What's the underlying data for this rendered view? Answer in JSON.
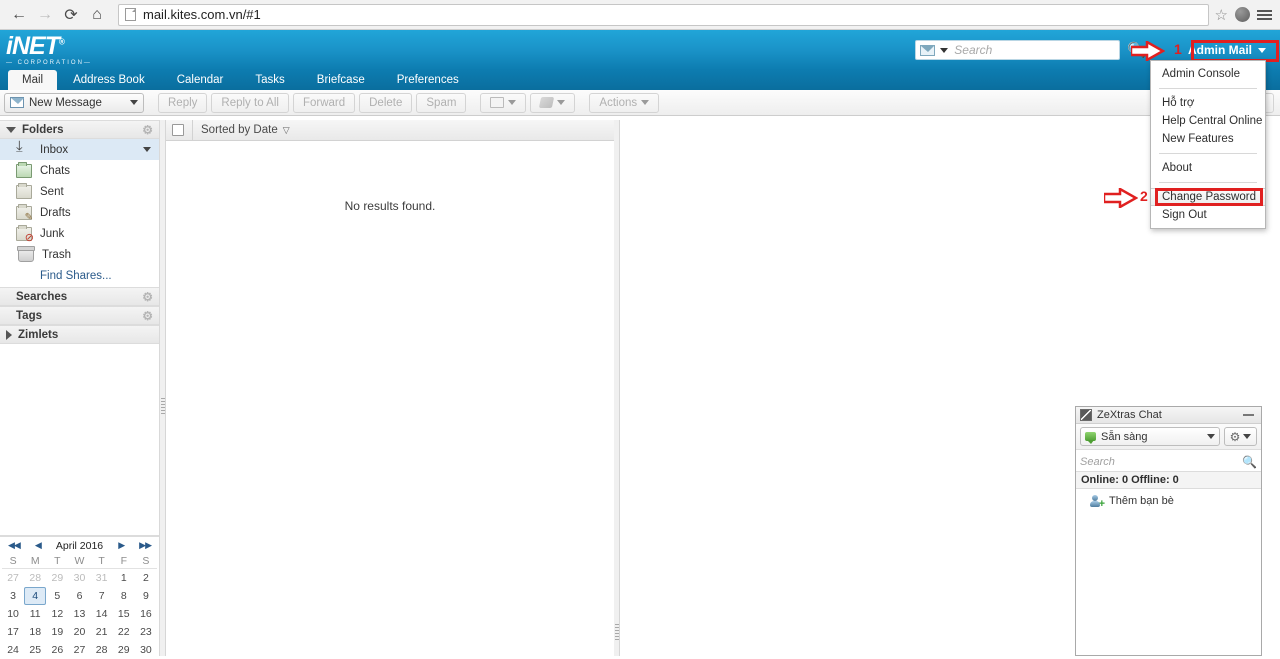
{
  "browser": {
    "back_icon": "←",
    "forward_icon": "→",
    "reload_icon": "⟳",
    "home_icon": "⌂",
    "url": "mail.kites.com.vn/#1",
    "star_icon": "☆",
    "profile_icon": "profile-globe-icon",
    "menu_icon": "hamburger-menu-icon"
  },
  "header": {
    "logo_text": "iNET",
    "logo_reg": "®",
    "logo_sub": "CORPORATION",
    "search": {
      "placeholder": "Search",
      "scope_icon": "envelope-icon"
    },
    "search_button_icon": "🔍",
    "account_label": "Admin Mail"
  },
  "annotations": [
    {
      "id": "1",
      "label": "1"
    },
    {
      "id": "2",
      "label": "2"
    }
  ],
  "tabs": [
    {
      "label": "Mail",
      "active": true
    },
    {
      "label": "Address Book",
      "active": false
    },
    {
      "label": "Calendar",
      "active": false
    },
    {
      "label": "Tasks",
      "active": false
    },
    {
      "label": "Briefcase",
      "active": false
    },
    {
      "label": "Preferences",
      "active": false
    }
  ],
  "toolbar": {
    "new_message": "New Message",
    "reply": "Reply",
    "reply_all": "Reply to All",
    "forward": "Forward",
    "delete": "Delete",
    "spam": "Spam",
    "move_icon": "move-to-folder-icon",
    "tag_icon": "tag-icon",
    "actions": "Actions"
  },
  "account_menu": {
    "items": [
      {
        "label": "Admin Console",
        "sep_after": true,
        "highlight": false
      },
      {
        "label": "Hỗ trợ",
        "sep_after": false,
        "highlight": false
      },
      {
        "label": "Help Central Online",
        "sep_after": false,
        "highlight": false
      },
      {
        "label": "New Features",
        "sep_after": true,
        "highlight": false
      },
      {
        "label": "About",
        "sep_after": true,
        "highlight": false
      },
      {
        "label": "Change Password",
        "sep_after": false,
        "highlight": true
      },
      {
        "label": "Sign Out",
        "sep_after": false,
        "highlight": false
      }
    ]
  },
  "sidebar": {
    "folders_header": "Folders",
    "folders": [
      {
        "label": "Inbox",
        "icon": "inbox-icon",
        "selected": true,
        "has_caret": true
      },
      {
        "label": "Chats",
        "icon": "chats-folder-icon",
        "selected": false,
        "has_caret": false
      },
      {
        "label": "Sent",
        "icon": "sent-folder-icon",
        "selected": false,
        "has_caret": false
      },
      {
        "label": "Drafts",
        "icon": "drafts-folder-icon",
        "selected": false,
        "has_caret": false
      },
      {
        "label": "Junk",
        "icon": "junk-folder-icon",
        "selected": false,
        "has_caret": false
      },
      {
        "label": "Trash",
        "icon": "trash-icon",
        "selected": false,
        "has_caret": false
      }
    ],
    "find_shares": "Find Shares...",
    "searches_header": "Searches",
    "tags_header": "Tags",
    "zimlets_header": "Zimlets",
    "gear_icon": "⚙"
  },
  "calendar": {
    "title": "April 2016",
    "first_icon": "◀◀",
    "prev_icon": "◀",
    "next_icon": "▶",
    "last_icon": "▶▶",
    "dow": [
      "S",
      "M",
      "T",
      "W",
      "T",
      "F",
      "S"
    ],
    "weeks": [
      [
        {
          "d": "27",
          "out": true
        },
        {
          "d": "28",
          "out": true
        },
        {
          "d": "29",
          "out": true
        },
        {
          "d": "30",
          "out": true
        },
        {
          "d": "31",
          "out": true
        },
        {
          "d": "1",
          "out": false
        },
        {
          "d": "2",
          "out": false
        }
      ],
      [
        {
          "d": "3",
          "out": false
        },
        {
          "d": "4",
          "out": false,
          "today": true
        },
        {
          "d": "5",
          "out": false
        },
        {
          "d": "6",
          "out": false
        },
        {
          "d": "7",
          "out": false
        },
        {
          "d": "8",
          "out": false
        },
        {
          "d": "9",
          "out": false
        }
      ],
      [
        {
          "d": "10",
          "out": false
        },
        {
          "d": "11",
          "out": false
        },
        {
          "d": "12",
          "out": false
        },
        {
          "d": "13",
          "out": false
        },
        {
          "d": "14",
          "out": false
        },
        {
          "d": "15",
          "out": false
        },
        {
          "d": "16",
          "out": false
        }
      ],
      [
        {
          "d": "17",
          "out": false
        },
        {
          "d": "18",
          "out": false
        },
        {
          "d": "19",
          "out": false
        },
        {
          "d": "20",
          "out": false
        },
        {
          "d": "21",
          "out": false
        },
        {
          "d": "22",
          "out": false
        },
        {
          "d": "23",
          "out": false
        }
      ],
      [
        {
          "d": "24",
          "out": false
        },
        {
          "d": "25",
          "out": false
        },
        {
          "d": "26",
          "out": false
        },
        {
          "d": "27",
          "out": false
        },
        {
          "d": "28",
          "out": false
        },
        {
          "d": "29",
          "out": false
        },
        {
          "d": "30",
          "out": false
        }
      ]
    ]
  },
  "mail_list": {
    "sorted_by": "Sorted by Date",
    "sort_arrow": "▽",
    "empty_text": "No results found."
  },
  "chat": {
    "title": "ZeXtras Chat",
    "status": "Sẵn sàng",
    "search_placeholder": "Search",
    "search_icon": "🔍",
    "counts": "Online: 0 Offline: 0",
    "add_buddy": "Thêm bạn bè",
    "minimize_icon": "minimize-icon",
    "gear_icon": "⚙"
  },
  "colors": {
    "brand_blue": "#1a93c8",
    "header_dark": "#0d7cb0",
    "annotation_red": "#e02020",
    "selection_blue": "#dce9f5"
  }
}
